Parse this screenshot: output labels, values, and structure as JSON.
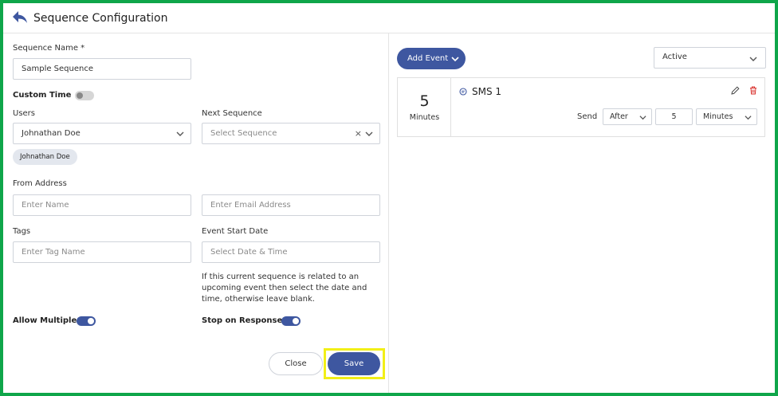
{
  "header": {
    "title": "Sequence Configuration"
  },
  "form": {
    "sequence_name_label": "Sequence Name *",
    "sequence_name_value": "Sample Sequence",
    "custom_time_label": "Custom Time",
    "custom_time_on": false,
    "users_label": "Users",
    "users_value": "Johnathan Doe",
    "users_chip": "Johnathan Doe",
    "next_sequence_label": "Next Sequence",
    "next_sequence_placeholder": "Select Sequence",
    "from_address_label": "From Address",
    "from_name_placeholder": "Enter Name",
    "from_email_placeholder": "Enter Email Address",
    "tags_label": "Tags",
    "tags_placeholder": "Enter Tag Name",
    "event_start_label": "Event Start Date",
    "event_start_placeholder": "Select Date & Time",
    "helper_text": "If this current sequence is related to an upcoming event then select the date and time, otherwise leave blank.",
    "allow_multiple_label": "Allow Multiple",
    "allow_multiple_on": true,
    "stop_on_response_label": "Stop on Response",
    "stop_on_response_on": true
  },
  "actions": {
    "close_label": "Close",
    "save_label": "Save"
  },
  "events_panel": {
    "add_event_label": "Add Event",
    "status_value": "Active",
    "events": [
      {
        "delay_value": "5",
        "delay_unit": "Minutes",
        "type_icon": "sms-icon",
        "name": "SMS 1",
        "send_label": "Send",
        "timing": "After",
        "amount": "5",
        "unit": "Minutes"
      }
    ]
  },
  "colors": {
    "frame_border": "#0fa64a",
    "save_highlight": "#f2ef17",
    "primary": "#3e57a0",
    "delete": "#d9302c"
  }
}
